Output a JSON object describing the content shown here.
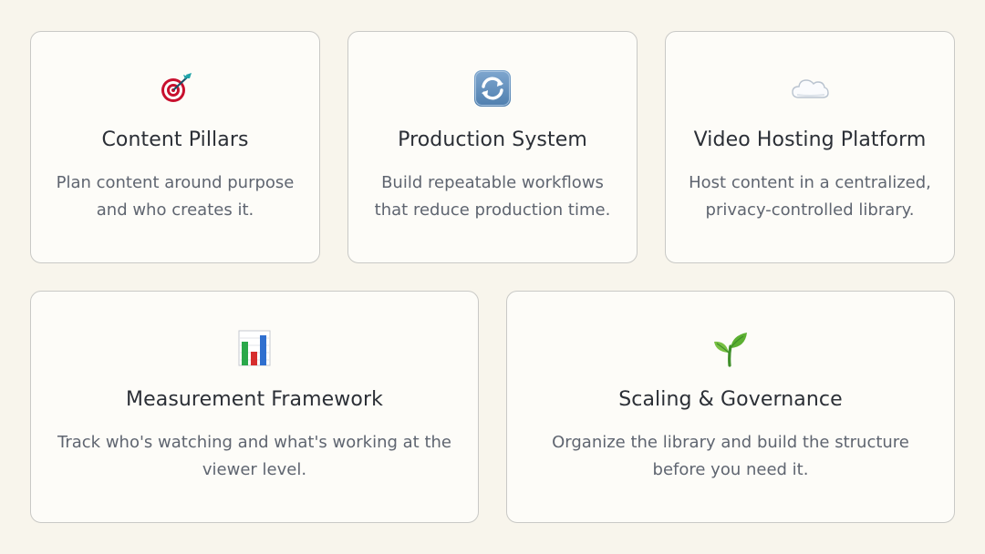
{
  "cards": [
    {
      "icon": "target-dart-icon",
      "title": "Content Pillars",
      "description": "Plan content around purpose\nand who creates it."
    },
    {
      "icon": "refresh-arrows-icon",
      "title": "Production System",
      "description": "Build repeatable workflows\nthat reduce production time."
    },
    {
      "icon": "cloud-icon",
      "title": "Video Hosting Platform",
      "description": "Host content in a centralized,\nprivacy-controlled library."
    },
    {
      "icon": "bar-chart-icon",
      "title": "Measurement Framework",
      "description": "Track who's watching and what's working at the\nviewer level."
    },
    {
      "icon": "seedling-icon",
      "title": "Scaling & Governance",
      "description": "Organize the library and build the structure\nbefore you need it."
    }
  ],
  "colors": {
    "background": "#f8f5ec",
    "card": "#fdfcf8",
    "border": "#c9c9c6",
    "title": "#2b2f36",
    "description": "#5f6570"
  }
}
